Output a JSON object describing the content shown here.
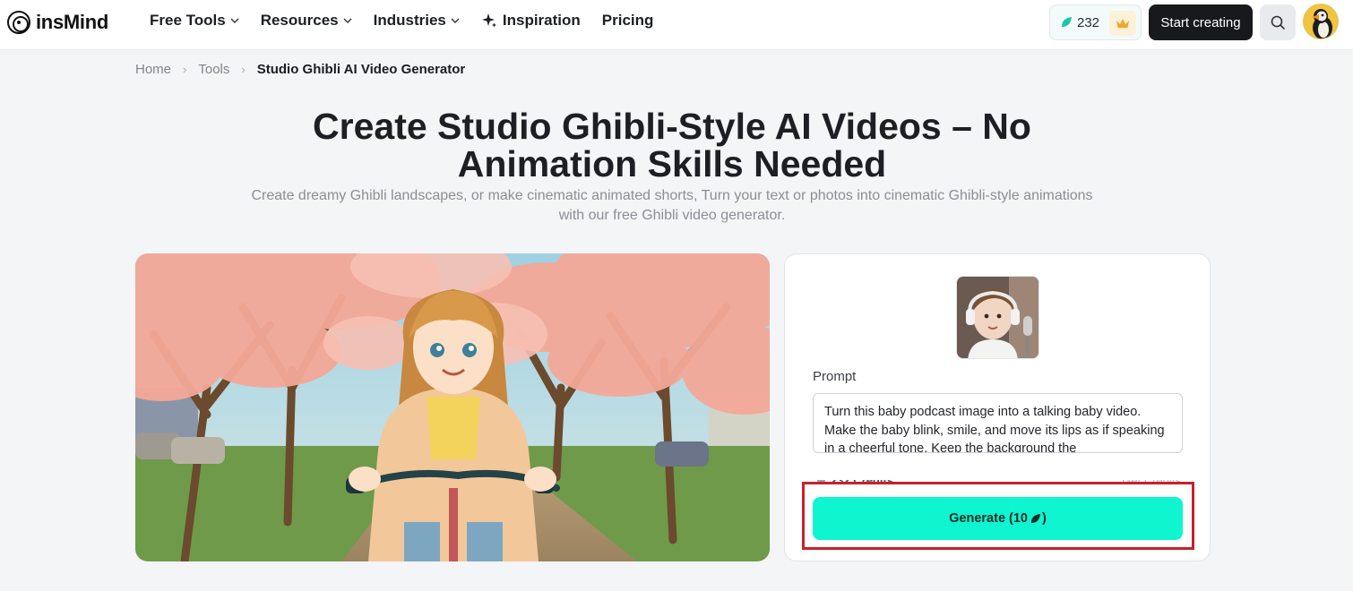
{
  "header": {
    "logo_text": "insMind",
    "nav": [
      {
        "label": "Free Tools",
        "has_dropdown": true
      },
      {
        "label": "Resources",
        "has_dropdown": true
      },
      {
        "label": "Industries",
        "has_dropdown": true
      },
      {
        "label": "Inspiration",
        "icon": "sparkle-icon"
      },
      {
        "label": "Pricing"
      }
    ],
    "credits": "232",
    "start_button": "Start creating"
  },
  "breadcrumb": {
    "home": "Home",
    "tools": "Tools",
    "current": "Studio Ghibli AI Video Generator"
  },
  "main": {
    "title": "Create Studio Ghibli-Style AI Videos – No Animation Skills Needed",
    "subtitle": "Create dreamy Ghibli landscapes, or make cinematic animated shorts, Turn your text or photos into cinematic Ghibli-style animations with our free Ghibli video generator."
  },
  "panel": {
    "prompt_label": "Prompt",
    "prompt_value": "Turn this baby podcast image into a talking baby video. Make the baby blink, smile, and move its lips as if speaking in a cheerful tone. Keep the background the",
    "credits_left": "232 Credits",
    "credits_right": "Get Credits",
    "generate_label": "Generate (10",
    "generate_suffix": ")"
  },
  "colors": {
    "accent": "#0ef5cf",
    "highlight": "#c8202c",
    "dark_button": "#17191c"
  }
}
